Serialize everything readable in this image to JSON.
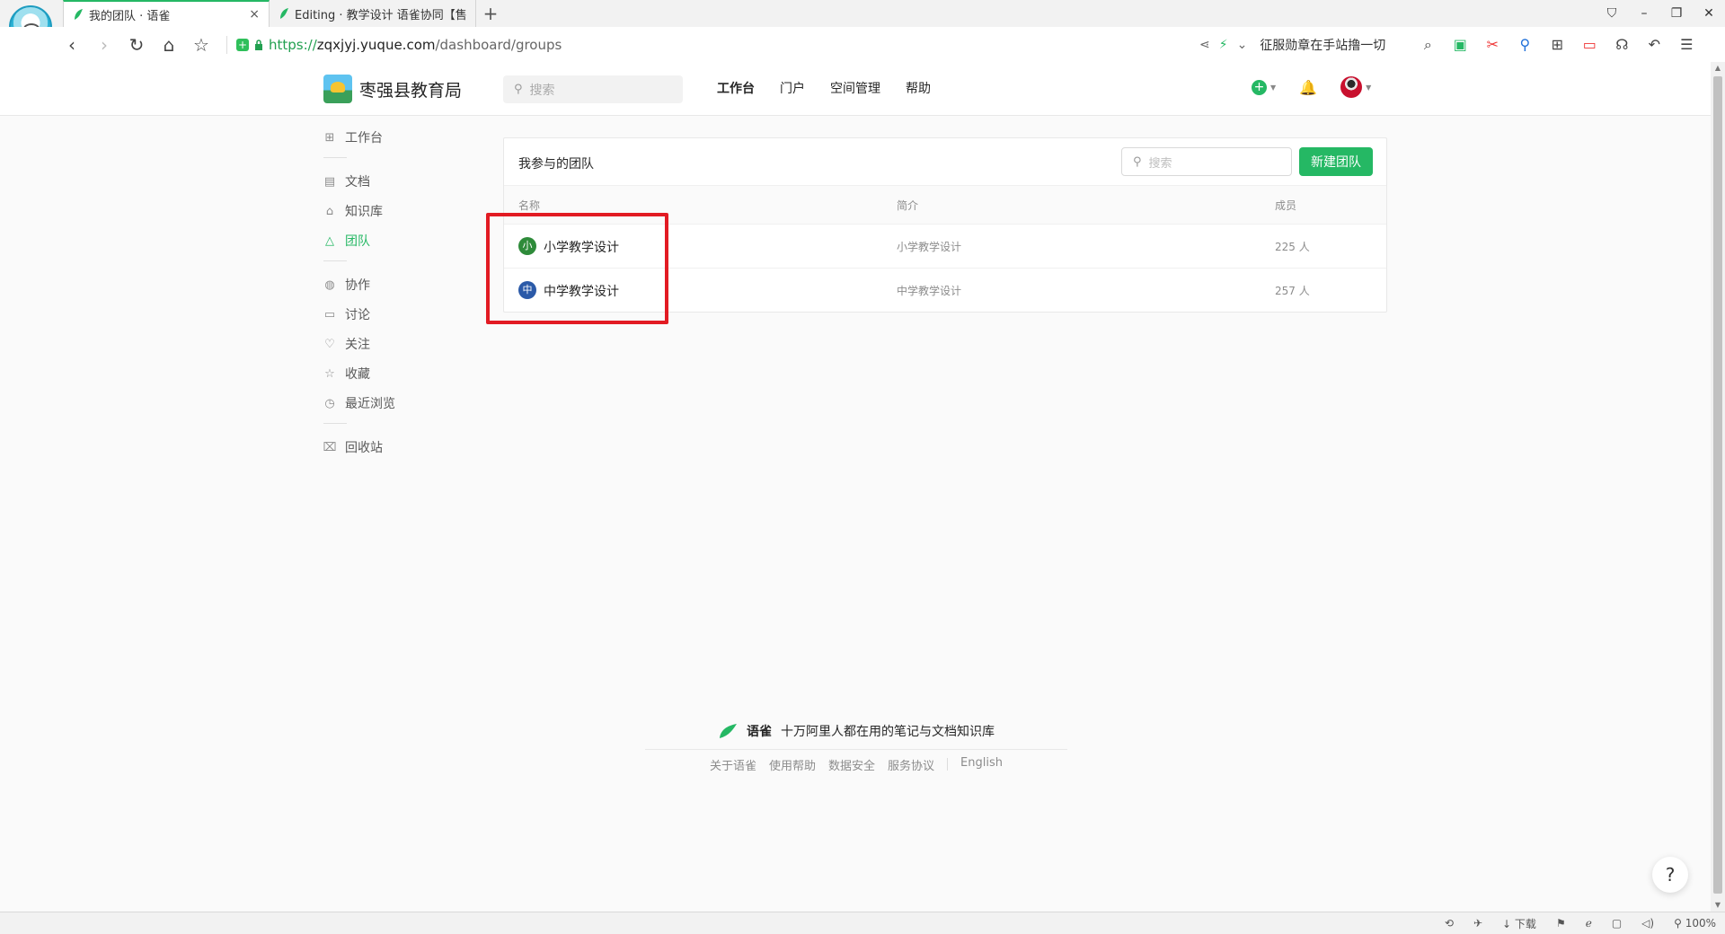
{
  "browser": {
    "tabs": [
      {
        "title": "我的团队 · 语雀",
        "close": "×"
      },
      {
        "title": "Editing · 教学设计 语雀协同【售"
      }
    ],
    "new_tab": "+",
    "window_controls": {
      "skin": "⛉",
      "minimize": "–",
      "restore": "❐",
      "close": "✕"
    },
    "nav": {
      "back": "‹",
      "forward": "›",
      "refresh": "↻",
      "home": "⌂",
      "star": "☆"
    },
    "url": {
      "proto": "https://",
      "host": "zqxjyj.yuque.com",
      "path": "/dashboard/groups"
    },
    "search_hint": "征服勋章在手站撸一切",
    "status_download": "下载",
    "zoom": "100%"
  },
  "header": {
    "org_name": "枣强县教育局",
    "search_placeholder": "搜索",
    "nav": [
      {
        "label": "工作台",
        "active": true
      },
      {
        "label": "门户"
      },
      {
        "label": "空间管理"
      },
      {
        "label": "帮助"
      }
    ]
  },
  "sidebar": {
    "items": [
      {
        "label": "工作台",
        "icon": "grid-icon"
      },
      {
        "label": "文档",
        "icon": "document-icon"
      },
      {
        "label": "知识库",
        "icon": "library-icon"
      },
      {
        "label": "团队",
        "icon": "team-icon",
        "active": true
      },
      {
        "label": "协作",
        "icon": "globe-icon"
      },
      {
        "label": "讨论",
        "icon": "comment-icon"
      },
      {
        "label": "关注",
        "icon": "heart-icon"
      },
      {
        "label": "收藏",
        "icon": "star-icon"
      },
      {
        "label": "最近浏览",
        "icon": "clock-icon"
      },
      {
        "label": "回收站",
        "icon": "trash-icon"
      }
    ]
  },
  "panel": {
    "title": "我参与的团队",
    "search_placeholder": "搜索",
    "new_button": "新建团队",
    "columns": {
      "name": "名称",
      "desc": "简介",
      "members": "成员"
    },
    "rows": [
      {
        "badge": "小",
        "badge_color": "#2e8b3a",
        "name": "小学教学设计",
        "desc": "小学教学设计",
        "members": "225 人"
      },
      {
        "badge": "中",
        "badge_color": "#2b5aa8",
        "name": "中学教学设计",
        "desc": "中学教学设计",
        "members": "257 人"
      }
    ]
  },
  "footer": {
    "brand": "语雀",
    "tagline": "十万阿里人都在用的笔记与文档知识库",
    "links": [
      "关于语雀",
      "使用帮助",
      "数据安全",
      "服务协议"
    ],
    "lang": "English"
  },
  "help_button": "?",
  "colors": {
    "brand": "#25b864",
    "highlight": "#e21b23"
  }
}
